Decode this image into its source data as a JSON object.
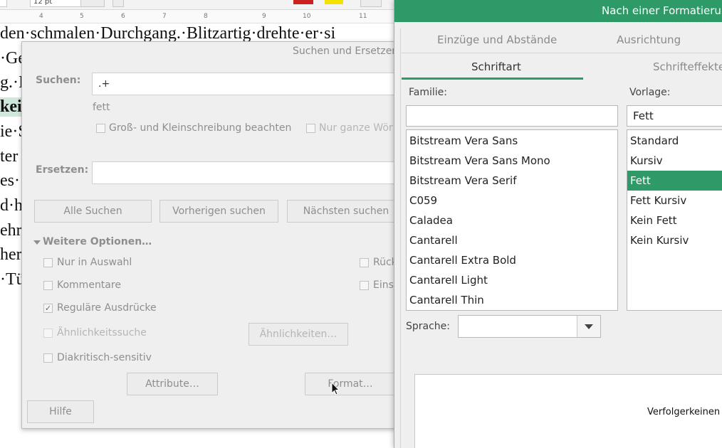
{
  "writer": {
    "toolbar": {
      "font_size": "12 pt",
      "buttons": [
        "bold-button",
        "italic-button",
        "underline-button",
        "superscript-button",
        "font-color-button",
        "highlight-button",
        "align-left-button"
      ]
    },
    "ruler": {
      "marks": [
        "4",
        "5",
        "6",
        "7",
        "8",
        "9",
        "10",
        "11"
      ]
    },
    "lines": [
      "den·schmalen·Durchgang.·Blitzartig·drehte·er·si",
      "·Ge",
      "g.·I",
      "kei",
      "ie·S",
      "ter",
      "es·",
      "d·h",
      "ehr",
      "her",
      "·Tü"
    ]
  },
  "search_replace": {
    "title": "Suchen und Ersetzen",
    "search_label": "Suchen:",
    "search_value": ".+",
    "search_attr": "fett",
    "match_case": "Groß- und Kleinschreibung beachten",
    "whole_words": "Nur ganze Wör",
    "replace_label": "Ersetzen:",
    "replace_value": "",
    "find_all": "Alle Suchen",
    "find_prev": "Vorherigen suchen",
    "find_next": "Nächsten suchen",
    "more_options": "Weitere Optionen…",
    "opt_selection": "Nur in Auswahl",
    "opt_comments": "Kommentare",
    "opt_regex": "Reguläre Ausdrücke",
    "opt_similarity": "Ähnlichkeitssuche",
    "similarity_btn": "Ähnlichkeiten…",
    "opt_diacritics": "Diakritisch-sensitiv",
    "opt_backwards": "Rück",
    "opt_styles": "Eins",
    "attributes_btn": "Attribute…",
    "format_btn": "Format…",
    "help_btn": "Hilfe",
    "regex_checked": true
  },
  "char_dialog": {
    "title": "Nach einer Formatierung",
    "tabs_row1": [
      "Einzüge und Abstände",
      "Ausrichtung"
    ],
    "tabs_row2": [
      "Schriftart",
      "Schrifteffekte"
    ],
    "active_tab": "Schriftart",
    "family_label": "Familie:",
    "family_value": "",
    "families": [
      "Bitstream Vera Sans",
      "Bitstream Vera Sans Mono",
      "Bitstream Vera Serif",
      "C059",
      "Caladea",
      "Cantarell",
      "Cantarell Extra Bold",
      "Cantarell Light",
      "Cantarell Thin"
    ],
    "style_label": "Vorlage:",
    "style_value": "Fett",
    "styles": [
      "Standard",
      "Kursiv",
      "Fett",
      "Fett Kursiv",
      "Kein Fett",
      "Kein Kursiv"
    ],
    "selected_style": "Fett",
    "language_label": "Sprache:",
    "language_value": "",
    "preview_text": "Verfolgerkeinen",
    "accent_color": "#2e9a68"
  }
}
